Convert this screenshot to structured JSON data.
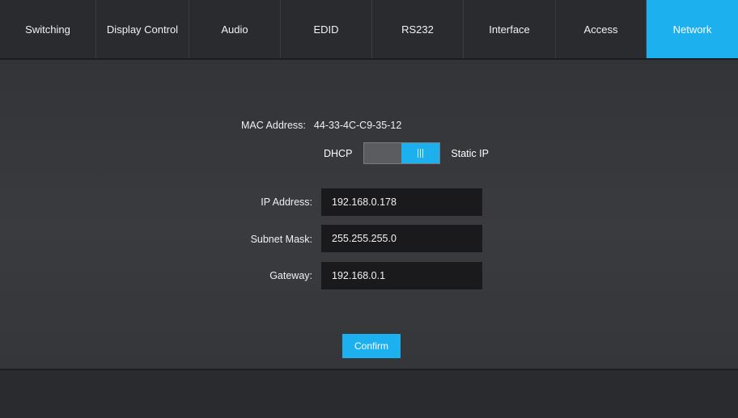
{
  "tabs": [
    {
      "label": "Switching"
    },
    {
      "label": "Display Control"
    },
    {
      "label": "Audio"
    },
    {
      "label": "EDID"
    },
    {
      "label": "RS232"
    },
    {
      "label": "Interface"
    },
    {
      "label": "Access"
    },
    {
      "label": "Network"
    }
  ],
  "active_tab": "Network",
  "network": {
    "mac_label": "MAC Address:",
    "mac_value": "44-33-4C-C9-35-12",
    "mode_left_label": "DHCP",
    "mode_right_label": "Static IP",
    "mode_selected": "Static IP",
    "toggle_icon": "grip-lines-icon",
    "ip_label": "IP Address:",
    "ip_value": "192.168.0.178",
    "subnet_label": "Subnet Mask:",
    "subnet_value": "255.255.255.0",
    "gateway_label": "Gateway:",
    "gateway_value": "192.168.0.1",
    "confirm_label": "Confirm"
  },
  "colors": {
    "accent": "#1cb0ee",
    "background": "#2f3033",
    "input_background": "#1a1a1c",
    "text": "#ffffff"
  }
}
